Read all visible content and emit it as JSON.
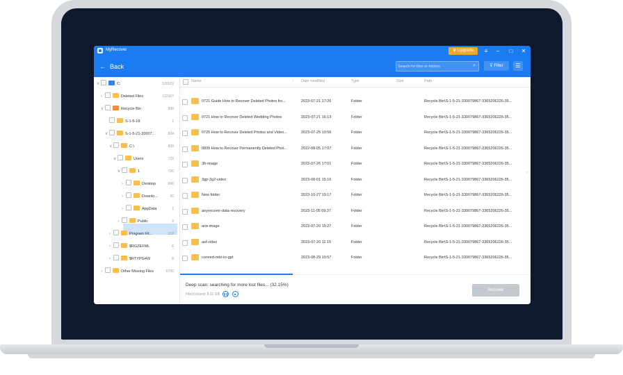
{
  "app": {
    "name": "MyRecover",
    "upgrade_label": "Upgrade",
    "window_buttons": [
      "≡",
      "–",
      "□",
      "✕"
    ]
  },
  "toolbar": {
    "back_label": "Back",
    "search_placeholder": "Search for files or folders",
    "filter_label": "Filter"
  },
  "icons": {
    "back": "arrow-left-icon",
    "search": "search-icon",
    "filter": "filter-icon",
    "list_view": "list-view-icon",
    "upgrade": "crown-icon"
  },
  "colors": {
    "accent": "#1a7cf0",
    "upgrade": "#f7a823",
    "folder": "#f7c04d",
    "recover_disabled": "#c4c9d0"
  },
  "tree": [
    {
      "label": "C:",
      "count": "120022",
      "chev": "∨",
      "icon": "drive"
    },
    {
      "label": "Deleted Files",
      "count": "122167",
      "chev": "›",
      "icon": "folder"
    },
    {
      "label": "Recycle Bin",
      "count": "835",
      "chev": "∨",
      "icon": "bin"
    },
    {
      "label": "S-1-5-18",
      "count": "1",
      "chev": "",
      "icon": "folder"
    },
    {
      "label": "S-1-5-21-33007...",
      "count": "834",
      "chev": "∨",
      "icon": "folder"
    },
    {
      "label": "C:\\",
      "count": "833",
      "chev": "∨",
      "icon": "folder"
    },
    {
      "label": "Users",
      "count": "722",
      "chev": "∨",
      "icon": "folder"
    },
    {
      "label": "1",
      "count": "720",
      "chev": "∨",
      "icon": "folder"
    },
    {
      "label": "Desktop",
      "count": "690",
      "chev": "›",
      "icon": "folder"
    },
    {
      "label": "Downlo...",
      "count": "20",
      "chev": "›",
      "icon": "folder"
    },
    {
      "label": "AppData",
      "count": "1",
      "chev": "›",
      "icon": "folder"
    },
    {
      "label": "Public",
      "count": "2",
      "chev": "›",
      "icon": "folder"
    },
    {
      "label": "Program Fil...",
      "count": "218",
      "chev": "›",
      "icon": "folder"
    },
    {
      "label": "$RGZEFML",
      "count": "6",
      "chev": "›",
      "icon": "folder"
    },
    {
      "label": "$RTYPG4W",
      "count": "8",
      "chev": "›",
      "icon": "folder"
    },
    {
      "label": "Other Missing Files",
      "count": "5720",
      "chev": "›",
      "icon": "folder"
    }
  ],
  "table": {
    "headers": {
      "name": "Name",
      "date": "Date modified",
      "type": "Type",
      "size": "Size",
      "path": "Path"
    },
    "rows": [
      {
        "name": "0721 Guide How to Recover Deleted Photos fro...",
        "date": "2023-07-21 17:26",
        "type": "Folder",
        "path": "Recycle Bin\\S-1-5-21-330079867-3365206226-35..."
      },
      {
        "name": "0721 How to Recover Deleted Wedding Photos",
        "date": "2023-07-21 16:13",
        "type": "Folder",
        "path": "Recycle Bin\\S-1-5-21-330079867-3365206226-35..."
      },
      {
        "name": "0725 How to Recover Deleted Photos and Video...",
        "date": "2023-07-25 10:56",
        "type": "Folder",
        "path": "Recycle Bin\\S-1-5-21-330079867-3365206226-35..."
      },
      {
        "name": "0805 How to Recover Permanently Deleted Phot...",
        "date": "2022-08-05 17:07",
        "type": "Folder",
        "path": "Recycle Bin\\S-1-5-21-330079867-3365206226-35..."
      },
      {
        "name": "3fr-image",
        "date": "2023-07-26 17:01",
        "type": "Folder",
        "path": "Recycle Bin\\S-1-5-21-330079867-3365206226-35..."
      },
      {
        "name": "3gp-3g2-video",
        "date": "2023-08-01 15:16",
        "type": "Folder",
        "path": "Recycle Bin\\S-1-5-21-330079867-3365206226-35..."
      },
      {
        "name": "New folder",
        "date": "2023-10-27 19:17",
        "type": "Folder",
        "path": "Recycle Bin\\S-1-5-21-330079867-3365206226-35..."
      },
      {
        "name": "anyrecover-data-recovery",
        "date": "2023-11-05 09:37",
        "type": "Folder",
        "path": "Recycle Bin\\S-1-5-21-330079867-3365206226-35..."
      },
      {
        "name": "arw-image",
        "date": "2023-07-20 15:27",
        "type": "Folder",
        "path": "Recycle Bin\\S-1-5-21-330079867-3365206226-35..."
      },
      {
        "name": "asf-video",
        "date": "2023-07-20 11:15",
        "type": "Folder",
        "path": "Recycle Bin\\S-1-5-21-330079867-3365206226-35..."
      },
      {
        "name": "convert-mbr-to-gpt",
        "date": "2023-08-29 10:57",
        "type": "Folder",
        "path": "Recycle Bin\\S-1-5-21-330079867-3365206226-35..."
      }
    ]
  },
  "status": {
    "title": "Deep scan: searching for more lost files... (32.15%)",
    "files_found": "File(s) found: 8.01 GB",
    "progress": 0.3215,
    "recover_label": "Recover"
  }
}
